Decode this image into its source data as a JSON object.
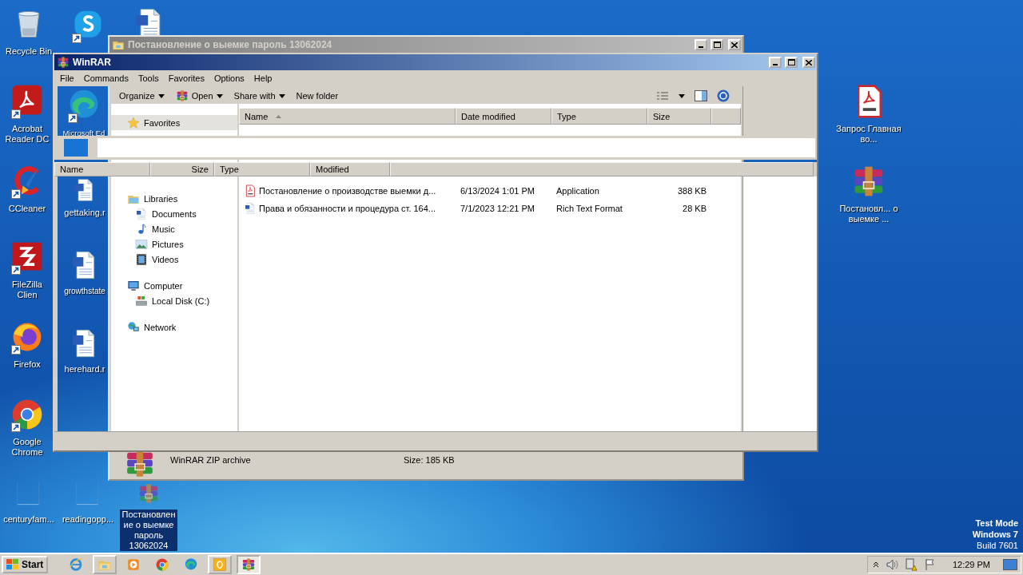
{
  "desktop": {
    "icons": [
      {
        "kind": "recycle",
        "label": "Recycle Bin",
        "shortcut": false,
        "selected": false
      },
      {
        "kind": "skype",
        "shortcut": true,
        "selected": false
      },
      {
        "kind": "word",
        "shortcut": false,
        "selected": false
      },
      {
        "kind": "acrobat",
        "label": "Acrobat Reader DC",
        "shortcut": true,
        "selected": false
      },
      {
        "kind": "edge",
        "label": "Microsoft Ed",
        "shortcut": true,
        "selected": false
      },
      {
        "kind": "ccleaner",
        "label": "CCleaner",
        "shortcut": true,
        "selected": false
      },
      {
        "kind": "word",
        "label": "gettaking.r",
        "shortcut": false,
        "selected": false
      },
      {
        "kind": "filezilla",
        "label": "FileZilla Clien",
        "shortcut": true,
        "selected": false
      },
      {
        "kind": "word",
        "label": "growthstate",
        "shortcut": false,
        "selected": false
      },
      {
        "kind": "firefox",
        "label": "Firefox",
        "shortcut": true,
        "selected": false
      },
      {
        "kind": "word",
        "label": "herehard.r",
        "shortcut": false,
        "selected": false
      },
      {
        "kind": "chrome",
        "label": "Google Chrome",
        "shortcut": true,
        "selected": false
      },
      {
        "kind": "blank",
        "label": "centuryfam...",
        "shortcut": false,
        "selected": false
      },
      {
        "kind": "blank",
        "label": "readingopp...",
        "shortcut": false,
        "selected": false
      },
      {
        "kind": "winrar",
        "label": "Постановление о выемке пароль 13062024",
        "shortcut": false,
        "selected": true
      },
      {
        "kind": "pdf",
        "label": "Запрос Главная во...",
        "shortcut": false,
        "selected": false
      },
      {
        "kind": "winrar",
        "label": "Постановл... о выемке  ...",
        "shortcut": false,
        "selected": false
      }
    ],
    "system_text": [
      "Test Mode",
      "Windows 7",
      "Build 7601"
    ]
  },
  "explorer": {
    "title": "Постановление о выемке  пароль 13062024",
    "active": false,
    "toolbar": [
      {
        "label": "Organize",
        "kind": "text",
        "dropdown": true
      },
      {
        "label": "Open",
        "kind": "app",
        "dropdown": true
      },
      {
        "label": "Share with",
        "kind": "text",
        "dropdown": true
      },
      {
        "label": "New folder",
        "kind": "text",
        "dropdown": false
      }
    ],
    "nav": [
      {
        "label": "Favorites",
        "kind": "star",
        "selected": true
      },
      {
        "label": "Libraries",
        "kind": "library",
        "selected": false,
        "children": [
          {
            "label": "Documents",
            "kind": "documents",
            "selected": false
          },
          {
            "label": "Music",
            "kind": "music",
            "selected": false
          },
          {
            "label": "Pictures",
            "kind": "pictures",
            "selected": false
          },
          {
            "label": "Videos",
            "kind": "videos",
            "selected": false
          }
        ]
      },
      {
        "label": "Computer",
        "kind": "computer",
        "selected": false,
        "children": [
          {
            "label": "Local Disk (C:)",
            "kind": "disk",
            "selected": false
          }
        ]
      },
      {
        "label": "Network",
        "kind": "network",
        "selected": false
      }
    ],
    "columns": [
      {
        "label": "Name",
        "sorted": true
      },
      {
        "label": "Date modified",
        "sorted": false
      },
      {
        "label": "Type",
        "sorted": false
      },
      {
        "label": "Size",
        "sorted": false
      }
    ],
    "files": [
      {
        "kind": "pdf",
        "name": "Постановление о производстве выемки д...",
        "modified": "6/13/2024 1:01 PM",
        "type": "Application",
        "size": "388 KB"
      },
      {
        "kind": "word",
        "name": "Права и обязанности и процедура ст. 164...",
        "modified": "7/1/2023 12:21 PM",
        "type": "Rich Text Format",
        "size": "28 KB"
      }
    ],
    "details": {
      "kind": "winrar",
      "type": "WinRAR ZIP archive",
      "size": "Size: 185 KB"
    }
  },
  "winrar": {
    "title": "WinRAR",
    "active": true,
    "menu": [
      "File",
      "Commands",
      "Tools",
      "Favorites",
      "Options",
      "Help"
    ],
    "columns": [
      "Name",
      "Size",
      "Type",
      "Modified"
    ]
  },
  "taskbar": {
    "start": "Start",
    "apps": [
      {
        "kind": "ie",
        "running": false,
        "active": false
      },
      {
        "kind": "explorer",
        "running": true,
        "active": false
      },
      {
        "kind": "media",
        "running": false,
        "active": false
      },
      {
        "kind": "chrome",
        "running": false,
        "active": false
      },
      {
        "kind": "edge",
        "running": false,
        "active": false
      },
      {
        "kind": "outlook",
        "running": true,
        "active": false
      },
      {
        "kind": "winrar",
        "running": true,
        "active": true
      }
    ],
    "clock": "12:29 PM"
  }
}
